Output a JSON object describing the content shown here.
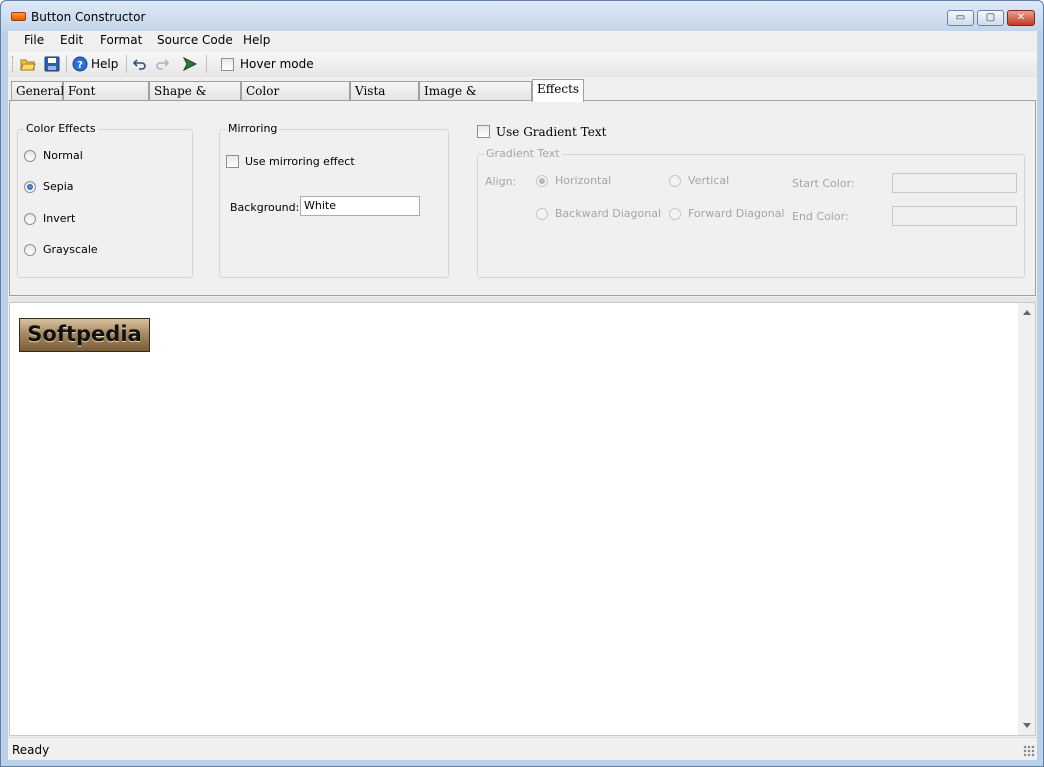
{
  "window": {
    "title": "Button Constructor",
    "controls": {
      "minimize": "▭",
      "maximize": "▢",
      "close": "✕"
    }
  },
  "menu": {
    "items": [
      "File",
      "Edit",
      "Format",
      "Source Code",
      "Help"
    ]
  },
  "toolbar": {
    "icons": [
      "open-folder-icon",
      "save-disk-icon",
      "help-icon",
      "undo-icon",
      "redo-icon",
      "run-arrow-icon"
    ],
    "help_label": "Help",
    "hover_mode_label": "Hover mode",
    "hover_mode_checked": false
  },
  "tabs": {
    "items": [
      "General",
      "Font Settings",
      "Shape & Sizing",
      "Color Background",
      "Vista Style",
      "Image & Templates",
      "Effects"
    ],
    "active": "Effects"
  },
  "effects": {
    "color_effects": {
      "title": "Color Effects",
      "options": [
        "Normal",
        "Sepia",
        "Invert",
        "Grayscale"
      ],
      "selected": "Sepia"
    },
    "mirroring": {
      "title": "Mirroring",
      "use_label": "Use mirroring effect",
      "use_checked": false,
      "background_label": "Background:",
      "background_value": "White"
    },
    "gradient": {
      "use_label": "Use Gradient Text",
      "use_checked": false,
      "group_title": "Gradient Text",
      "align_label": "Align:",
      "options": [
        "Horizontal",
        "Vertical",
        "Backward Diagonal",
        "Forward Diagonal"
      ],
      "selected": "Horizontal",
      "start_color_label": "Start Color:",
      "start_color_value": "",
      "end_color_label": "End Color:",
      "end_color_value": ""
    }
  },
  "preview": {
    "button_text": "Softpedia",
    "effect_color": "#a88a62"
  },
  "status": {
    "text": "Ready"
  }
}
